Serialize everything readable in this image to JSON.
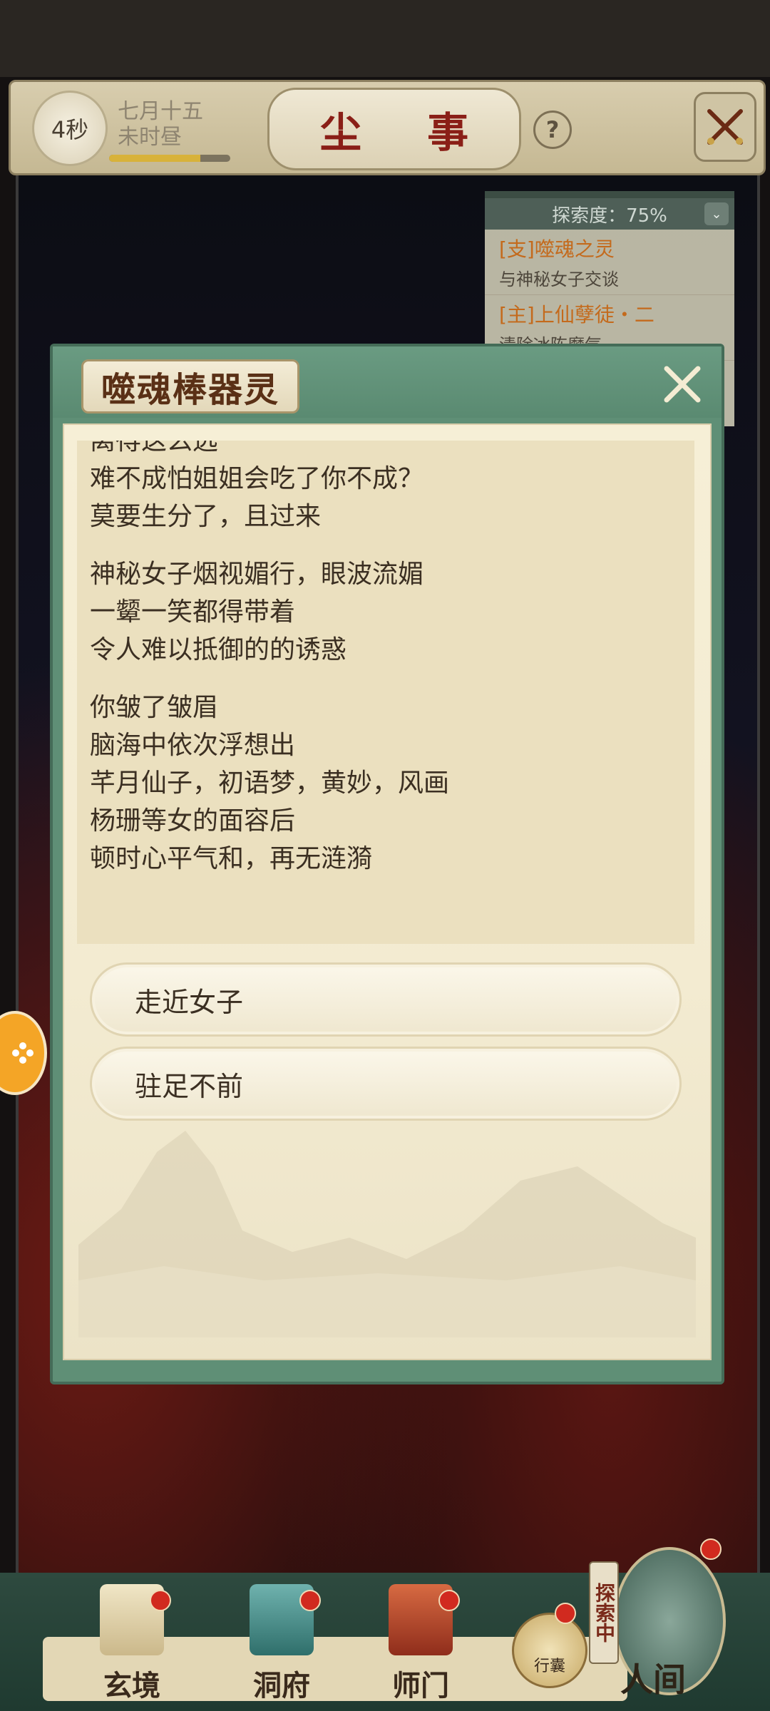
{
  "top_bar": {
    "timer": "4秒",
    "date": "七月十五",
    "hour": "未时昼",
    "title": "尘 事",
    "help": "?",
    "time_progress_percent": 75
  },
  "quest_panel": {
    "progress_label": "探索度：75%",
    "items": [
      {
        "title": "[支]噬魂之灵",
        "desc": "与神秘女子交谈"
      },
      {
        "title": "[主]上仙孽徒・二",
        "desc": "清除冰陈魔气"
      }
    ]
  },
  "dialog": {
    "title": "噬魂棒器灵",
    "paragraphs": [
      [
        "离得这么远",
        "难不成怕姐姐会吃了你不成？",
        "莫要生分了，且过来"
      ],
      [
        "神秘女子烟视媚行，眼波流媚",
        "一颦一笑都得带着",
        "令人难以抵御的的诱惑"
      ],
      [
        "你皱了皱眉",
        "脑海中依次浮想出",
        "芊月仙子，初语梦，黄妙，风画",
        "杨珊等女的面容后",
        "顿时心平气和，再无涟漪"
      ]
    ],
    "choices": [
      "走近女子",
      "驻足不前"
    ]
  },
  "bottom_nav": {
    "items": [
      "玄境",
      "洞府",
      "师门"
    ],
    "bag_label": "行囊",
    "explore_tag": "探索中",
    "main_label": "人间"
  },
  "colors": {
    "dialog_frame": "#5f8f76",
    "title_red": "#8a1f17",
    "quest_orange": "#c46a1c",
    "notification_red": "#d12a1f"
  }
}
